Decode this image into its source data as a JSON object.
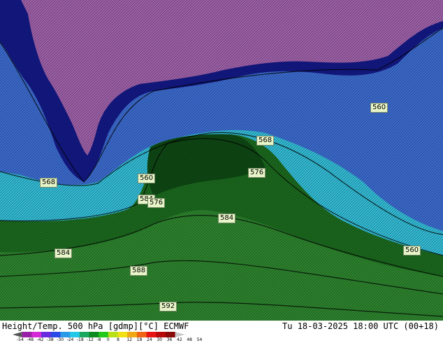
{
  "labels": {
    "l560a": "560",
    "l568a": "568",
    "l576a": "576",
    "l568b": "568",
    "l560b": "560",
    "l584a": "584",
    "l576b": "576",
    "l584b": "584",
    "l588": "588",
    "l592": "592",
    "l560c": "560"
  },
  "footer": {
    "title": "Height/Temp. 500 hPa [gdmp][°C] ECMWF",
    "time": "Tu 18-03-2025 18:00 UTC (00+18)"
  },
  "legend": {
    "ticks": [
      "-54",
      "-48",
      "-42",
      "-38",
      "-30",
      "-24",
      "-18",
      "-12",
      "-8",
      "0",
      "8",
      "12",
      "18",
      "24",
      "30",
      "36",
      "42",
      "48",
      "54"
    ],
    "colors": [
      "#555555",
      "#9a1fa8",
      "#d428d8",
      "#6a2ae0",
      "#2a4ae8",
      "#2a9ae8",
      "#22c8e8",
      "#1aa860",
      "#0e8a20",
      "#22c81a",
      "#b8e014",
      "#f0e014",
      "#f0a814",
      "#f06414",
      "#e81414",
      "#b80a0a",
      "#8a0a0a",
      "#c8c8c8"
    ]
  },
  "colors": {
    "purple": "#a565b0",
    "dark_blue": "#141a8c",
    "mid_blue": "#3e6ad6",
    "cyan": "#3ec8e0",
    "dark_green": "#0e4a14",
    "green": "#1f7a22",
    "light_green": "#3a9a3a"
  }
}
